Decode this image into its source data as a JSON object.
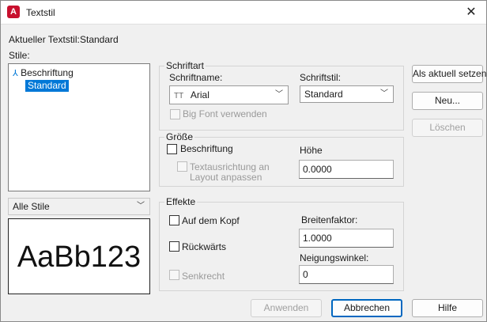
{
  "window": {
    "title": "Textstil",
    "app_icon_letter": "A"
  },
  "current_style": {
    "label": "Aktueller Textstil:",
    "value": "Standard"
  },
  "styles": {
    "label": "Stile:",
    "items": [
      {
        "label": "Beschriftung",
        "icon": "annotative-icon"
      },
      {
        "label": "Standard",
        "selected": true
      }
    ],
    "filter": {
      "value": "Alle Stile",
      "options": [
        "Alle Stile"
      ]
    },
    "preview_text": "AaBb123"
  },
  "font": {
    "legend": "Schriftart",
    "name_label": "Schriftname:",
    "name_value": "Arial",
    "name_icon": "truetype-font-icon",
    "style_label": "Schriftstil:",
    "style_value": "Standard",
    "bigfont_label": "Big Font verwenden"
  },
  "size": {
    "legend": "Größe",
    "annotative_label": "Beschriftung",
    "match_orientation_label_line1": "Textausrichtung an",
    "match_orientation_label_line2": "Layout anpassen",
    "height_label": "Höhe",
    "height_value": "0.0000"
  },
  "effects": {
    "legend": "Effekte",
    "upside_down_label": "Auf dem Kopf",
    "backwards_label": "Rückwärts",
    "vertical_label": "Senkrecht",
    "width_factor_label": "Breitenfaktor:",
    "width_factor_value": "1.0000",
    "oblique_label": "Neigungswinkel:",
    "oblique_value": "0"
  },
  "buttons": {
    "set_current": "Als aktuell setzen",
    "new": "Neu...",
    "delete": "Löschen",
    "apply": "Anwenden",
    "cancel": "Abbrechen",
    "help": "Hilfe"
  },
  "colors": {
    "accent": "#0078d7",
    "app_icon": "#c8102e"
  }
}
